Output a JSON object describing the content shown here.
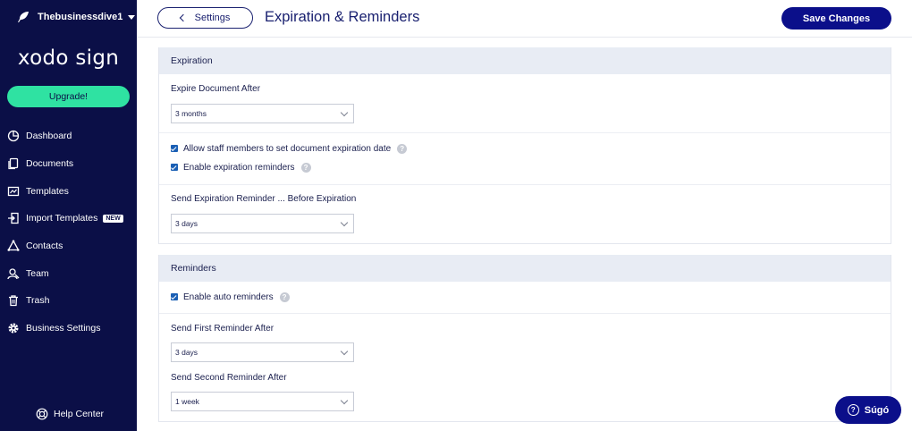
{
  "sidebar": {
    "org_name": "Thebusinessdive1",
    "logo_text": "xodo sign",
    "upgrade_label": "Upgrade!",
    "items": [
      {
        "label": "Dashboard",
        "icon": "pie-chart-icon"
      },
      {
        "label": "Documents",
        "icon": "documents-icon"
      },
      {
        "label": "Templates",
        "icon": "templates-icon"
      },
      {
        "label": "Import Templates",
        "icon": "import-icon",
        "badge": "NEW"
      },
      {
        "label": "Contacts",
        "icon": "contacts-icon"
      },
      {
        "label": "Team",
        "icon": "team-icon"
      },
      {
        "label": "Trash",
        "icon": "trash-icon"
      },
      {
        "label": "Business Settings",
        "icon": "gear-icon"
      }
    ],
    "help_center_label": "Help Center"
  },
  "header": {
    "back_label": "Settings",
    "title": "Expiration & Reminders",
    "save_label": "Save Changes"
  },
  "expiration": {
    "heading": "Expiration",
    "expire_after_label": "Expire Document After",
    "expire_after_value": "3 months",
    "allow_staff_label": "Allow staff members to set document expiration date",
    "allow_staff_checked": true,
    "enable_reminders_label": "Enable expiration reminders",
    "enable_reminders_checked": true,
    "reminder_before_label": "Send Expiration Reminder ... Before Expiration",
    "reminder_before_value": "3 days"
  },
  "reminders": {
    "heading": "Reminders",
    "auto_label": "Enable auto reminders",
    "auto_checked": true,
    "first_label": "Send First Reminder After",
    "first_value": "3 days",
    "second_label": "Send Second Reminder After",
    "second_value": "1 week"
  },
  "help_button": {
    "label": "Súgó"
  },
  "colors": {
    "sidebar_bg": "#0b0f47",
    "upgrade_bg": "#2fe2a2",
    "primary": "#0b0f8a",
    "section_head_bg": "#e8ecf4",
    "checkbox": "#1a5fb4"
  }
}
